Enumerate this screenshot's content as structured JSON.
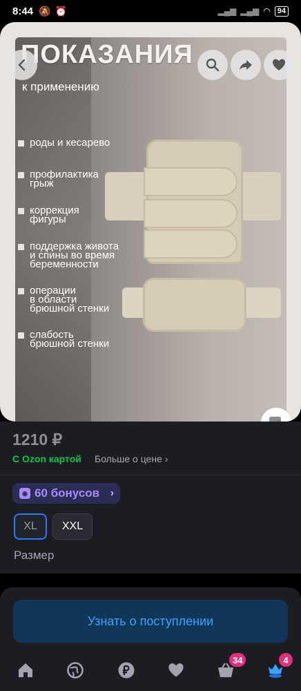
{
  "status_bar": {
    "time": "8:44",
    "battery": "94"
  },
  "product_image": {
    "headline": "ПОКАЗАНИЯ",
    "subheadline": "к применению",
    "indications": [
      "роды и кесарево",
      "профилактика\nгрыж",
      "коррекция\nфигуры",
      "поддержка живота\nи спины во время\nбеременности",
      "операции\nв области\nбрюшной стенки",
      "слабость\nбрюшной стенки"
    ]
  },
  "price": {
    "value": "1210 ₽",
    "ozon_card_label": "С Ozon картой",
    "more_label": "Больше о цене ›"
  },
  "bonus": {
    "label": "60 бонусов"
  },
  "sizes": {
    "options": [
      "XL",
      "XXL"
    ],
    "selected": "XL",
    "label": "Размер"
  },
  "cta": {
    "label": "Узнать о поступлении"
  },
  "nav": {
    "cart_badge": "34",
    "profile_badge": "4"
  },
  "colors": {
    "accent": "#3ea2ff",
    "ozon_green": "#10c44c",
    "bonus": "#a78bfa",
    "badge": "#e0307a"
  }
}
